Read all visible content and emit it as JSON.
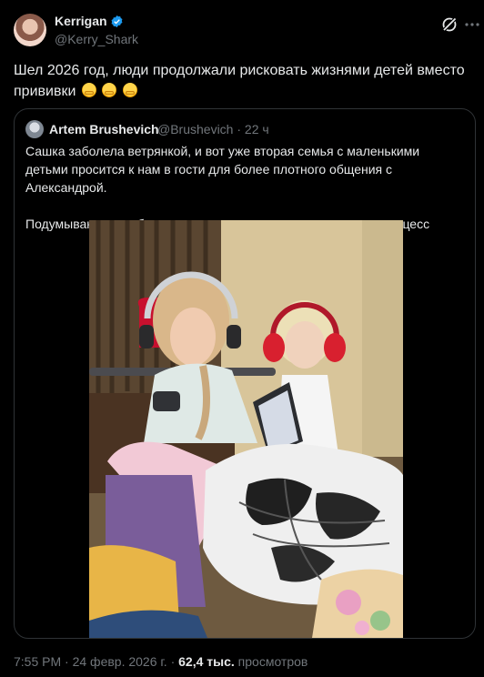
{
  "author": {
    "display_name": "Kerrigan",
    "handle": "@Kerry_Shark"
  },
  "post": {
    "text": "Шел 2026 год, люди продолжали рисковать жизнями детей вместо прививки",
    "emoji": [
      "grimacing-face",
      "grimacing-face",
      "grimacing-face"
    ]
  },
  "quote": {
    "display_name": "Artem Brushevich",
    "handle": "@Brushevich",
    "time": "22 ч",
    "paragraphs": [
      "Сашка заболела ветрянкой, и вот уже вторая семья с маленькими детьми просится к нам в гости для более плотного общения с Александрой.",
      "Подумываю дать объявление и монетизировать как-то этот процесс"
    ]
  },
  "footer": {
    "time": "7:55 PM",
    "date": "24 февр. 2026 г.",
    "views_count": "62,4 тыс.",
    "views_label": "просмотров"
  },
  "colors": {
    "background": "#000000",
    "text": "#e7e9ea",
    "muted": "#71767b",
    "border": "#2f3336",
    "verified": "#1d9bf0"
  }
}
